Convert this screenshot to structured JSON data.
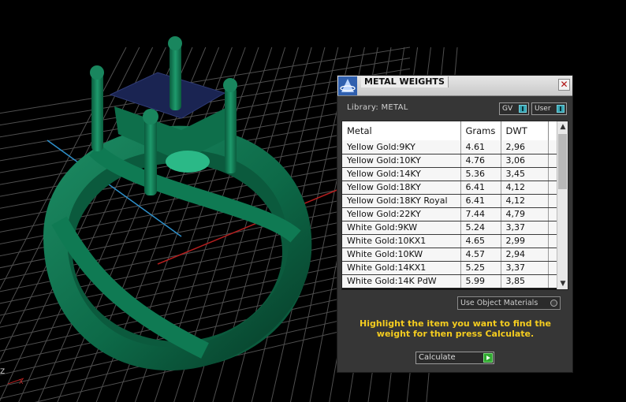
{
  "window": {
    "title": "METAL WEIGHTS",
    "close_label": "✕"
  },
  "library": {
    "label": "Library: METAL",
    "gv_label": "GV",
    "user_label": "User"
  },
  "table": {
    "columns": [
      "Metal",
      "Grams",
      "DWT"
    ],
    "rows": [
      [
        "Yellow Gold:9KY",
        "4.61",
        "2,96"
      ],
      [
        "Yellow Gold:10KY",
        "4.76",
        "3,06"
      ],
      [
        "Yellow Gold:14KY",
        "5.36",
        "3,45"
      ],
      [
        "Yellow Gold:18KY",
        "6.41",
        "4,12"
      ],
      [
        "Yellow Gold:18KY Royal",
        "6.41",
        "4,12"
      ],
      [
        "Yellow Gold:22KY",
        "7.44",
        "4,79"
      ],
      [
        "White Gold:9KW",
        "5.24",
        "3,37"
      ],
      [
        "White Gold:10KX1",
        "4.65",
        "2,99"
      ],
      [
        "White Gold:10KW",
        "4.57",
        "2,94"
      ],
      [
        "White Gold:14KX1",
        "5.25",
        "3,37"
      ],
      [
        "White Gold:14K PdW",
        "5.99",
        "3,85"
      ]
    ]
  },
  "use_object_materials_label": "Use Object Materials",
  "instructions": "Highlight the item you want to find the weight for then press Calculate.",
  "calculate_label": "Calculate",
  "axis_labels": {
    "z": "Z",
    "x": "X"
  },
  "colors": {
    "ring_green": "#0f6b4a",
    "gem_blue": "#1a2452",
    "grid": "#5a5a5a",
    "instruction_text": "#f4cc1f"
  }
}
